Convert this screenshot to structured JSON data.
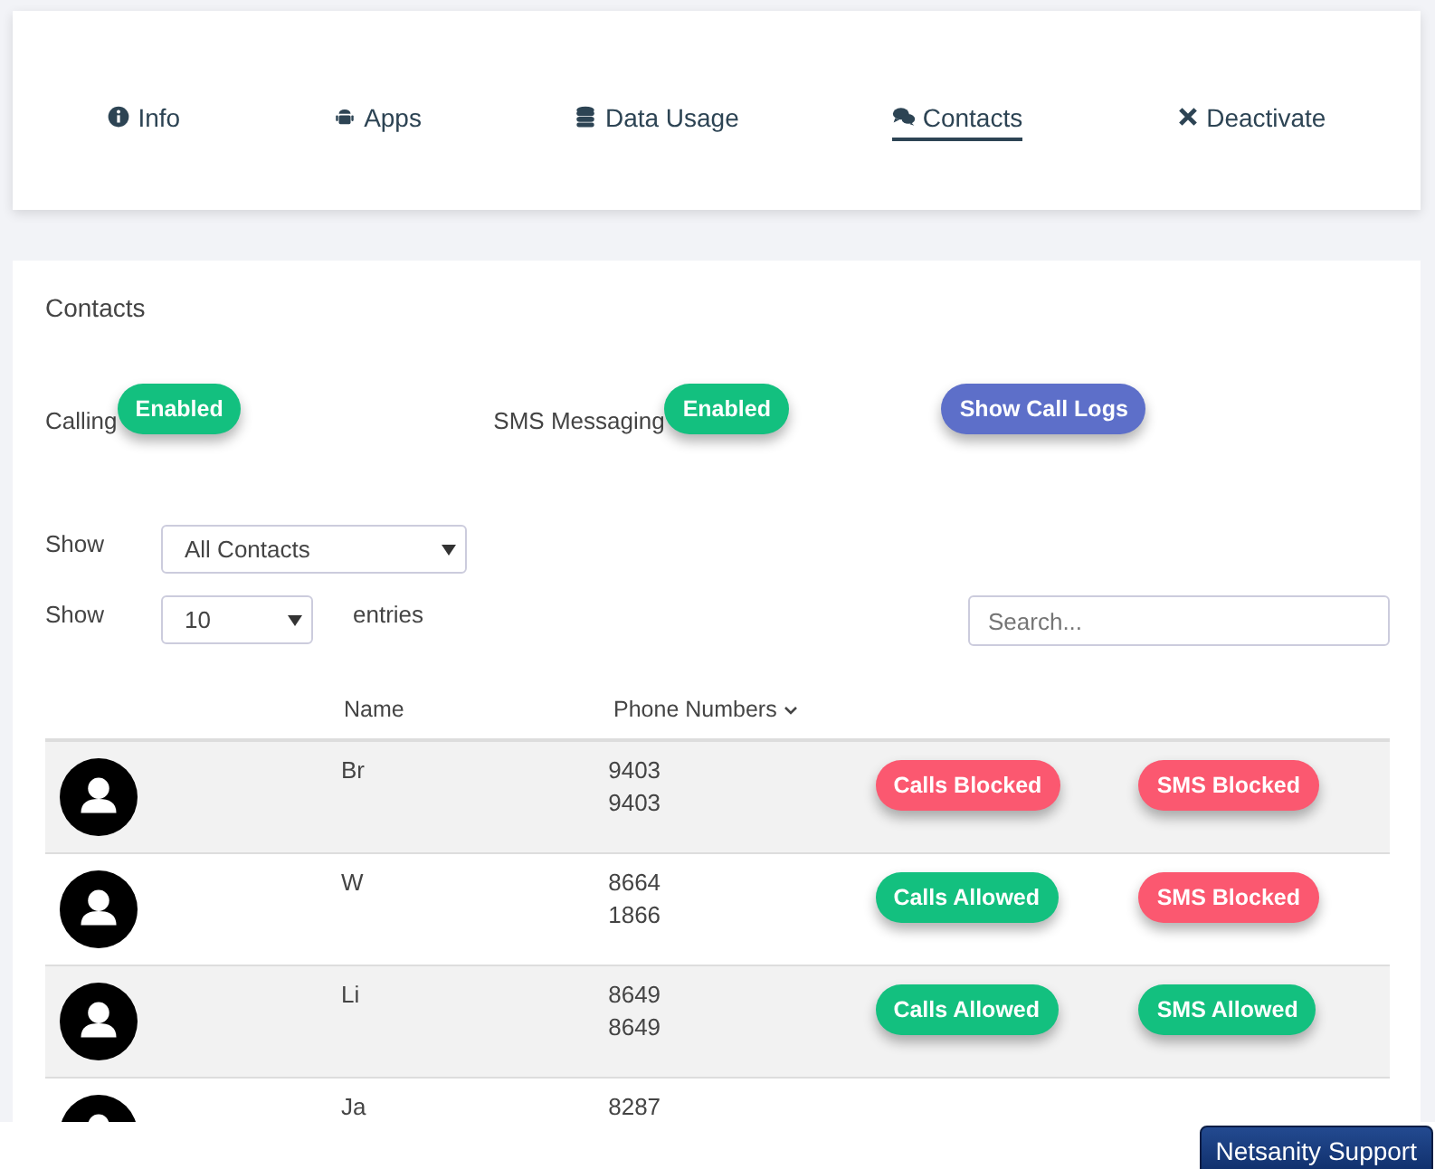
{
  "tabs": [
    {
      "label": "Info",
      "selected": false
    },
    {
      "label": "Apps",
      "selected": false
    },
    {
      "label": "Data Usage",
      "selected": false
    },
    {
      "label": "Contacts",
      "selected": true
    },
    {
      "label": "Deactivate",
      "selected": false
    }
  ],
  "section_title": "Contacts",
  "calling": {
    "label": "Calling",
    "button": "Enabled"
  },
  "sms": {
    "label": "SMS Messaging",
    "button": "Enabled"
  },
  "call_logs_button": "Show Call Logs",
  "filter": {
    "label": "Show",
    "value": "All Contacts"
  },
  "page_size": {
    "label": "Show",
    "value": "10",
    "suffix": "entries"
  },
  "search": {
    "placeholder": "Search..."
  },
  "table": {
    "columns": [
      "Name",
      "Phone Numbers"
    ],
    "rows": [
      {
        "name": "Br",
        "phones": [
          "9403",
          "9403"
        ],
        "calls": {
          "label": "Calls Blocked",
          "allowed": false
        },
        "sms": {
          "label": "SMS Blocked",
          "allowed": false
        }
      },
      {
        "name": "W",
        "phones": [
          "8664",
          "1866"
        ],
        "calls": {
          "label": "Calls Allowed",
          "allowed": true
        },
        "sms": {
          "label": "SMS Blocked",
          "allowed": false
        }
      },
      {
        "name": "Li",
        "phones": [
          "8649",
          "8649"
        ],
        "calls": {
          "label": "Calls Allowed",
          "allowed": true
        },
        "sms": {
          "label": "SMS Allowed",
          "allowed": true
        }
      },
      {
        "name": "Ja",
        "phones": [
          "8287"
        ]
      }
    ]
  },
  "support_button": "Netsanity Support"
}
